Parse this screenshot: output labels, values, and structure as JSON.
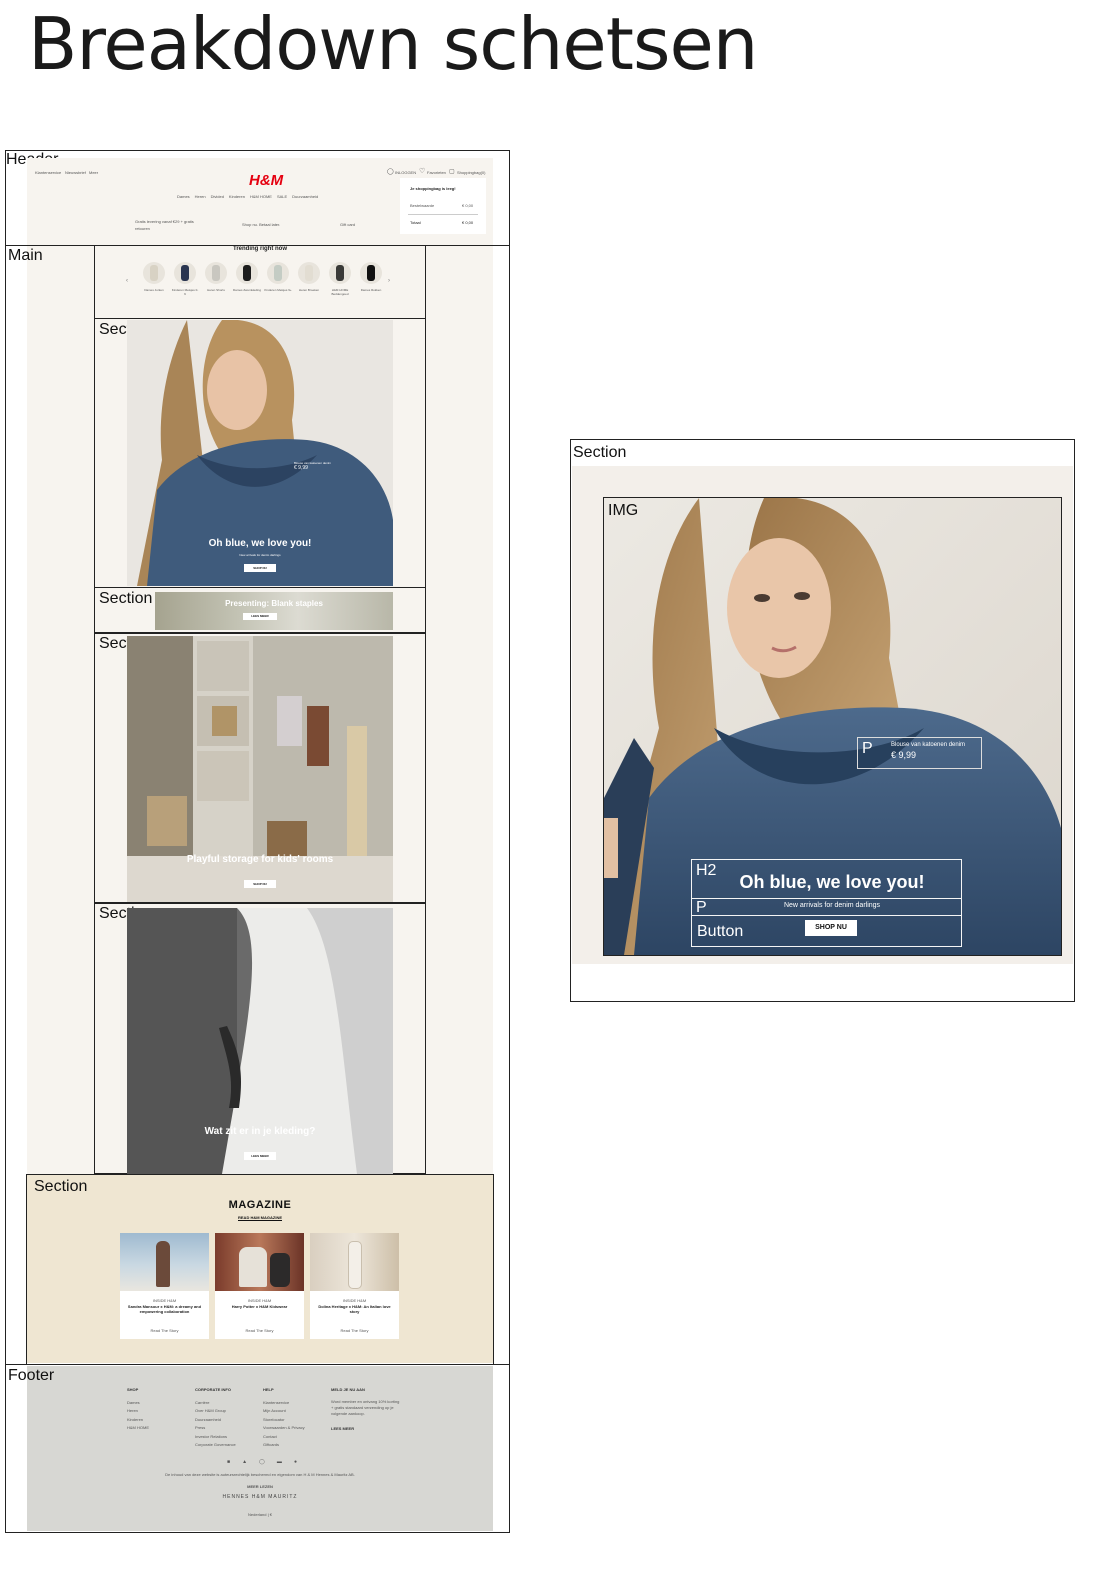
{
  "title": "Breakdown schetsen",
  "labels": {
    "header": "Header",
    "main": "Main",
    "section": "Section",
    "footer": "Footer",
    "img": "IMG",
    "h2": "H2",
    "p": "P",
    "button": "Button"
  },
  "header": {
    "top_links": [
      "Klantenservice",
      "Nieuwsbrief",
      "Meer"
    ],
    "logo": "H&M",
    "nav": [
      "Dames",
      "Heren",
      "Divided",
      "Kinderen",
      "H&M HOME",
      "SALE",
      "Duurzaamheid"
    ],
    "account": [
      "INLOGGEN",
      "Favorieten",
      "Shoppingbag(0)"
    ],
    "promo_left": "Gratis levering vanaf €29 + gratis retouren",
    "promo_mid": "Shop nu. Betaal later.",
    "promo_right": "Gift card",
    "bag_title": "Je shoppingbag is leeg!",
    "bag_row1_label": "Bestelwaarde",
    "bag_row1_value": "€ 0,00",
    "bag_row2_label": "Totaal",
    "bag_row2_value": "€ 0,00"
  },
  "trending": {
    "title": "Trending right now",
    "items": [
      {
        "label": "Dames Jurken",
        "color": "#d8d2c4"
      },
      {
        "label": "Kinderen Meisjes 0-9",
        "color": "#2a3550"
      },
      {
        "label": "Heren Shorts",
        "color": "#c9c7c0"
      },
      {
        "label": "Dames Zwemkleding",
        "color": "#1c1c1c"
      },
      {
        "label": "Kinderen Meisjes 9+",
        "color": "#c4ccc4"
      },
      {
        "label": "Heren Broeken",
        "color": "#e2ddd2"
      },
      {
        "label": "H&M HOME Beddengoed",
        "color": "#3a3a38"
      },
      {
        "label": "Dames Rokken",
        "color": "#111111"
      }
    ]
  },
  "hero": {
    "heading": "Oh blue, we love you!",
    "sub": "New arrivals for denim darlings",
    "button": "SHOP NU",
    "product_name": "Blouse van katoenen denim",
    "product_price": "€ 9,99"
  },
  "basics": {
    "heading": "Presenting: Blank staples",
    "button": "LEES MEER"
  },
  "kids": {
    "heading": "Playful storage for kids' rooms",
    "button": "SHOP NU"
  },
  "clothing": {
    "heading": "Wat zit er in je kleding?",
    "button": "LEES MEER"
  },
  "magazine": {
    "title": "MAGAZINE",
    "link": "READ H&M MAGAZINE",
    "cards": [
      {
        "kicker": "INSIDE H&M",
        "title": "Sandra Mansour x H&M: a dreamy and empowering collaboration",
        "cta": "Read The Story"
      },
      {
        "kicker": "INSIDE H&M",
        "title": "Harry Potter x H&M Kidswear",
        "cta": "Read The Story"
      },
      {
        "kicker": "INSIDE H&M",
        "title": "Dolina Heritage x H&M: An Italian love story",
        "cta": "Read The Story"
      }
    ]
  },
  "footer": {
    "cols": [
      {
        "head": "SHOP",
        "items": [
          "Dames",
          "Heren",
          "Kinderen",
          "H&M HOME"
        ]
      },
      {
        "head": "CORPORATE INFO",
        "items": [
          "Carrière",
          "Over H&M Group",
          "Duurzaamheid",
          "Press",
          "Investor Relations",
          "Corporate Governance"
        ]
      },
      {
        "head": "HELP",
        "items": [
          "Klantenservice",
          "Mijn Account",
          "Storelocator",
          "Voorwaarden & Privacy",
          "Contact",
          "Giftcards"
        ]
      },
      {
        "head": "MELD JE NU AAN",
        "items": [
          "Word member en ontvang 10% korting + gratis standaard verzending op je volgende aankoop."
        ]
      }
    ],
    "join": "LEES MEER",
    "legal": "De inhoud van deze website is auteursrechtelijk beschermd en eigendom van H & M Hennes & Mauritz AB.",
    "read_more": "MEER LEZEN",
    "brand": "HENNES  H&M  MAURITZ",
    "country": "Nederland | €"
  },
  "colors": {
    "frame": "#222222",
    "page_bg": "#f7f4ef",
    "magazine_bg": "#efe6d2",
    "footer_bg": "#d7d7d3",
    "hm_red": "#e50010",
    "denim": "#34506f",
    "denim_dark": "#223247"
  }
}
